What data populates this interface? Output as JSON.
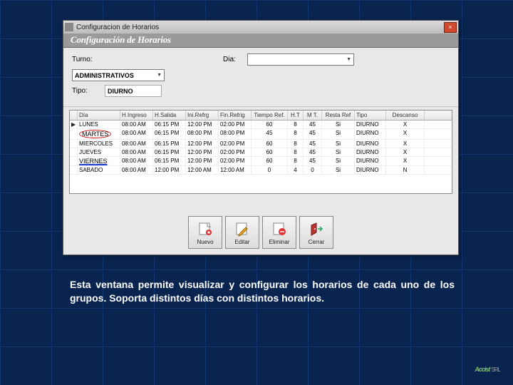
{
  "window": {
    "title": "Configuracion de Horarios",
    "banner": "Configuración de Horarios"
  },
  "form": {
    "turno_label": "Turno:",
    "turno_value": "ADMINISTRATIVOS",
    "tipo_label": "Tipo:",
    "tipo_value": "DIURNO",
    "dia_label": "Dia:",
    "dia_value": ""
  },
  "grid": {
    "headers": [
      "",
      "Día",
      "H.Ingreso",
      "H.Salida",
      "Ini.Refrg",
      "Fin.Refrig",
      "Tiempo Ref.",
      "H.T",
      "M T.",
      "Resta Ref",
      "Tipo",
      "Descanso"
    ],
    "rows": [
      {
        "ptr": "▶",
        "d": "LUNES",
        "hi": "08:00 AM",
        "hs": "06:15 PM",
        "ir": "12:00 PM",
        "fr": "02:00 PM",
        "tr": "60",
        "ht": "8",
        "mt": "45",
        "rr": "Si",
        "tp": "DIURNO",
        "de": "X"
      },
      {
        "ptr": "",
        "d": "MARTES",
        "hi": "08:00 AM",
        "hs": "06:15 PM",
        "ir": "08:00 PM",
        "fr": "08:00 PM",
        "tr": "45",
        "ht": "8",
        "mt": "45",
        "rr": "Si",
        "tp": "DIURNO",
        "de": "X",
        "circle": true
      },
      {
        "ptr": "",
        "d": "MIERCOLES",
        "hi": "08:00 AM",
        "hs": "06:15 PM",
        "ir": "12:00 PM",
        "fr": "02:00 PM",
        "tr": "60",
        "ht": "8",
        "mt": "45",
        "rr": "Si",
        "tp": "DIURNO",
        "de": "X"
      },
      {
        "ptr": "",
        "d": "JUEVES",
        "hi": "08:00 AM",
        "hs": "06:15 PM",
        "ir": "12:00 PM",
        "fr": "02:00 PM",
        "tr": "60",
        "ht": "8",
        "mt": "45",
        "rr": "Si",
        "tp": "DIURNO",
        "de": "X"
      },
      {
        "ptr": "",
        "d": "VIERNES",
        "hi": "08:00 AM",
        "hs": "06:15 PM",
        "ir": "12:00 PM",
        "fr": "02:00 PM",
        "tr": "60",
        "ht": "8",
        "mt": "45",
        "rr": "Si",
        "tp": "DIURNO",
        "de": "X",
        "uline": true
      },
      {
        "ptr": "",
        "d": "SABADO",
        "hi": "08:00 AM",
        "hs": "12:00 PM",
        "ir": "12:00 AM",
        "fr": "12:00 AM",
        "tr": "0",
        "ht": "4",
        "mt": "0",
        "rr": "Si",
        "tp": "DIURNO",
        "de": "N"
      }
    ]
  },
  "buttons": {
    "nuevo": "Nuevo",
    "editar": "Editar",
    "eliminar": "Eliminar",
    "cerrar": "Cerrar"
  },
  "caption": "Esta ventana permite visualizar y configurar los horarios de cada uno de los grupos. Soporta distintos días con distintos horarios.",
  "logo": "Accist",
  "logo_suffix": "SRL"
}
